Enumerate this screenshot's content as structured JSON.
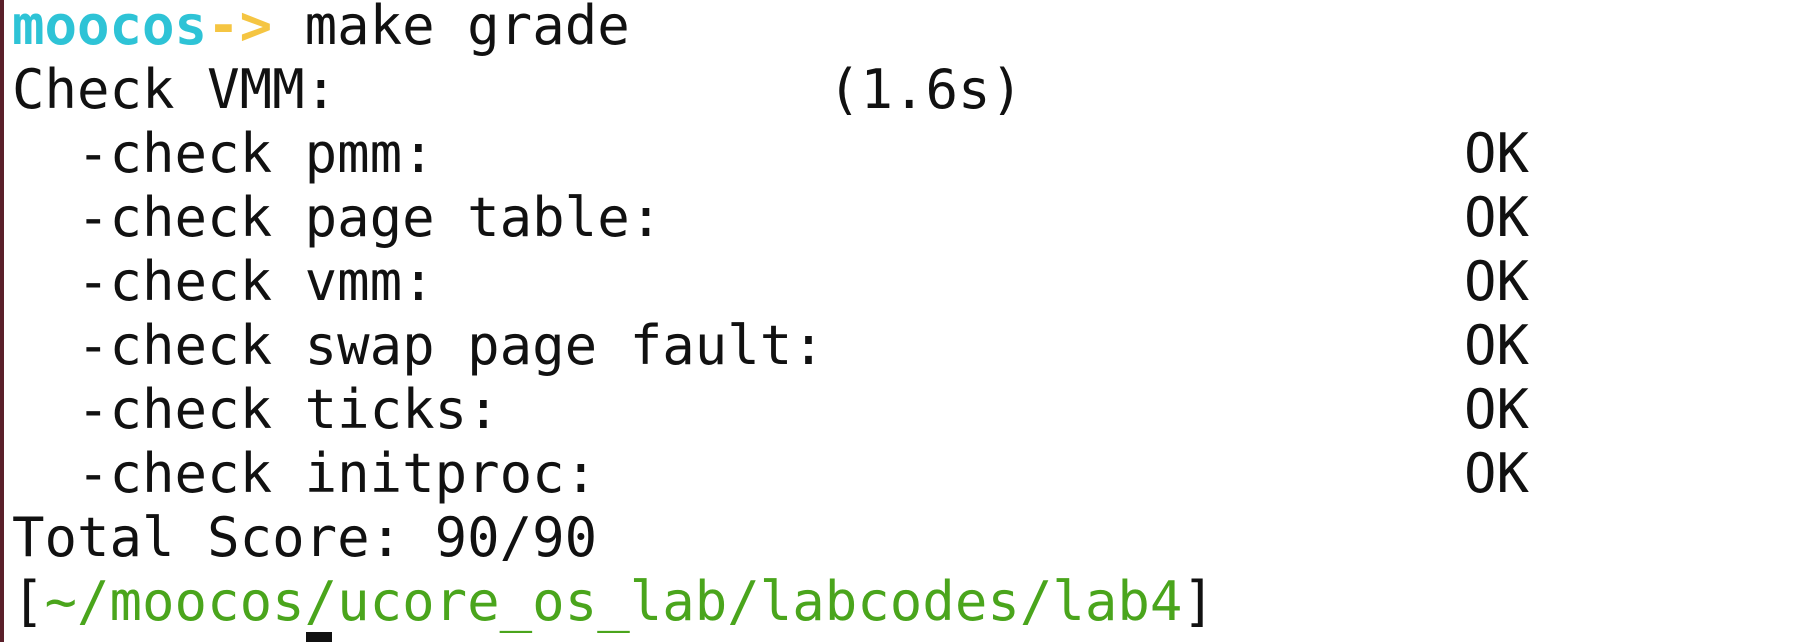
{
  "prompt": {
    "host": "moocos",
    "arrow": "->",
    "command": " make grade"
  },
  "section": {
    "title": "Check VMM:",
    "time": "(1.6s)"
  },
  "checks": [
    {
      "label": "  -check pmm:",
      "status": "OK"
    },
    {
      "label": "  -check page table:",
      "status": "OK"
    },
    {
      "label": "  -check vmm:",
      "status": "OK"
    },
    {
      "label": "  -check swap page fault:",
      "status": "OK"
    },
    {
      "label": "  -check ticks:",
      "status": "OK"
    },
    {
      "label": "  -check initproc:",
      "status": "OK"
    }
  ],
  "total_score": "Total Score: 90/90",
  "cwd": {
    "open": "[",
    "path": "~/moocos/ucore_os_lab/labcodes/lab4",
    "close": "]"
  },
  "colors": {
    "prompt_host": "#2ec3d6",
    "prompt_arrow": "#f5c542",
    "path": "#4aa51c",
    "text": "#111111",
    "background": "#ffffff"
  }
}
